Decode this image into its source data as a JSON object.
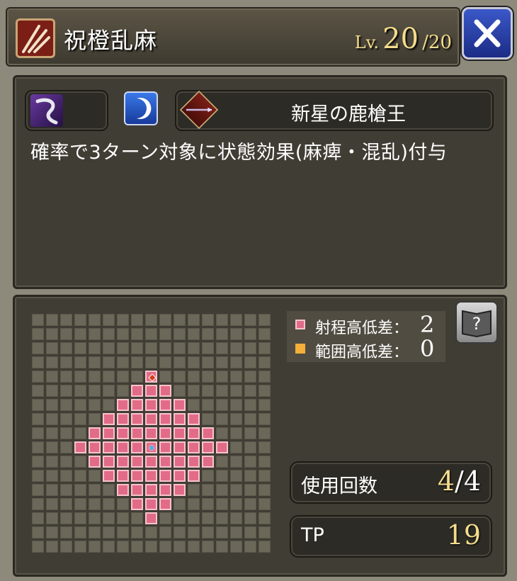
{
  "skill": {
    "name": "祝橙乱麻",
    "level_prefix": "Lv.",
    "level_current": "20",
    "level_max": "/20"
  },
  "weapon": {
    "name": "新星の鹿槍王"
  },
  "description": "確率で3ターン対象に状態効果(麻痺・混乱)付与",
  "legend": {
    "range_height": {
      "label": "射程高低差：",
      "value": "2",
      "color": "#e26c88"
    },
    "area_height": {
      "label": "範囲高低差：",
      "value": "0",
      "color": "#f4b038"
    }
  },
  "stats": {
    "uses_label": "使用回数",
    "uses_current": "4",
    "uses_max": "/4",
    "tp_label": "TP",
    "tp_value": "19"
  },
  "icons": {
    "skill_type": "claw-slash-icon",
    "element": "dark-element-icon",
    "moon": "crescent-moon-icon",
    "weapon": "spear-icon",
    "help": "help-book-icon",
    "close": "close-icon"
  },
  "range_grid": {
    "columns": 17,
    "rows": 17,
    "range_rows": [
      [
        4,
        8,
        8
      ],
      [
        5,
        7,
        9
      ],
      [
        6,
        6,
        10
      ],
      [
        7,
        5,
        11
      ],
      [
        8,
        4,
        12
      ],
      [
        9,
        3,
        13
      ],
      [
        10,
        4,
        12
      ],
      [
        11,
        5,
        11
      ],
      [
        12,
        6,
        10
      ],
      [
        13,
        7,
        9
      ],
      [
        14,
        8,
        8
      ]
    ],
    "target_cell": [
      4,
      8
    ],
    "center_cell": [
      9,
      8
    ]
  }
}
